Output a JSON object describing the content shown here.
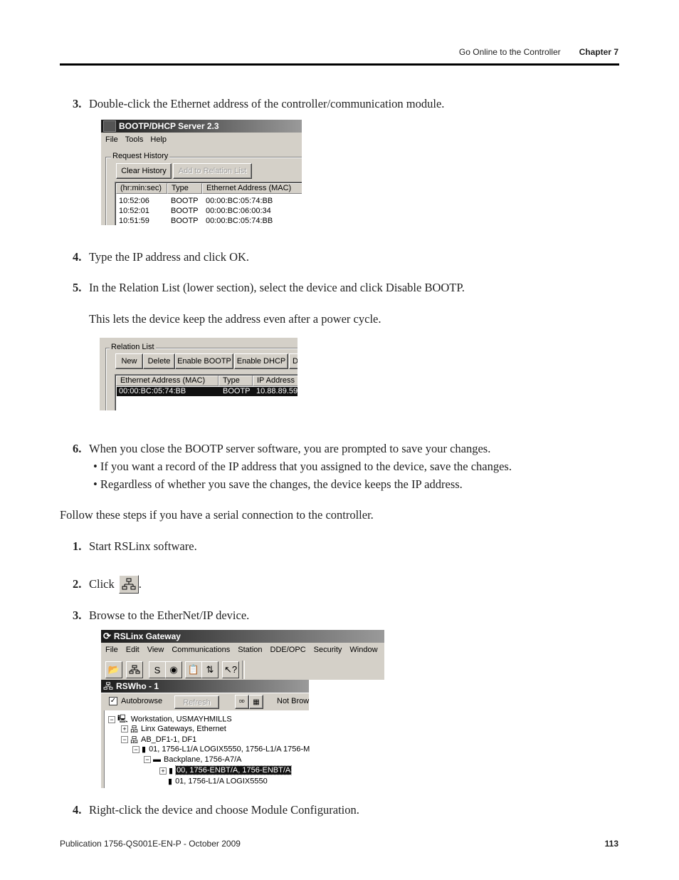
{
  "header": {
    "section": "Go Online to the Controller",
    "chapter": "Chapter 7"
  },
  "steps_a": [
    {
      "num": "3.",
      "text": "Double-click the Ethernet address of the controller/communication module."
    },
    {
      "num": "4.",
      "text": "Type the IP address and click OK."
    },
    {
      "num": "5.",
      "text": "In the Relation List (lower section), select the device and click Disable BOOTP."
    },
    {
      "num": "6.",
      "text": "When you close the BOOTP server software, you are prompted to save your changes."
    }
  ],
  "step5_note": "This lets the device keep the address even after a power cycle.",
  "step6_bullets": [
    "If you want a record of the IP address that you assigned to the device, save the changes.",
    "Regardless of whether you save the changes, the device keeps the IP address."
  ],
  "serial_intro": "Follow these steps if you have a serial connection to the controller.",
  "steps_b": [
    {
      "num": "1.",
      "text": "Start RSLinx software."
    },
    {
      "num": "2.",
      "text": "Click",
      "after": "."
    },
    {
      "num": "3.",
      "text": "Browse to the EtherNet/IP device."
    },
    {
      "num": "4.",
      "text": "Right-click the device and choose Module Configuration."
    }
  ],
  "bootp_window": {
    "title": "BOOTP/DHCP Server 2.3",
    "menu": [
      "File",
      "Tools",
      "Help"
    ],
    "group_label": "Request History",
    "buttons": {
      "clear": "Clear History",
      "add": "Add to Relation List"
    },
    "columns": [
      "(hr:min:sec)",
      "Type",
      "Ethernet Address (MAC)"
    ],
    "rows": [
      {
        "time": "10:52:06",
        "type": "BOOTP",
        "mac": "00:00:BC:05:74:BB"
      },
      {
        "time": "10:52:01",
        "type": "BOOTP",
        "mac": "00:00:BC:06:00:34"
      },
      {
        "time": "10:51:59",
        "type": "BOOTP",
        "mac": "00:00:BC:05:74:BB"
      }
    ]
  },
  "relation_list": {
    "group_label": "Relation List",
    "buttons": [
      "New",
      "Delete",
      "Enable BOOTP",
      "Enable DHCP",
      "D"
    ],
    "columns": [
      "Ethernet Address (MAC)",
      "Type",
      "IP Address"
    ],
    "rows": [
      {
        "mac": "00:00:BC:05:74:BB",
        "type": "BOOTP",
        "ip": "10.88.89.59"
      }
    ]
  },
  "rslinx": {
    "title": "RSLinx Gateway",
    "menu": [
      "File",
      "Edit",
      "View",
      "Communications",
      "Station",
      "DDE/OPC",
      "Security",
      "Window",
      "Help"
    ],
    "toolbar_icons": [
      "open-icon",
      "rswho-network-icon",
      "configure-driver-icon",
      "configure-shortcut-icon",
      "clipboard-icon",
      "topology-icon",
      "help-pointer-icon"
    ],
    "rswho": {
      "title": "RSWho - 1",
      "autobrowse_label": "Autobrowse",
      "autobrowse_checked": true,
      "refresh_label": "Refresh",
      "status": "Not Brow",
      "tree": [
        {
          "level": 0,
          "exp": "−",
          "icon": "workstation",
          "label": "Workstation, USMAYHMILLS"
        },
        {
          "level": 1,
          "exp": "+",
          "icon": "network",
          "label": "Linx Gateways, Ethernet"
        },
        {
          "level": 1,
          "exp": "−",
          "icon": "network",
          "label": "AB_DF1-1, DF1"
        },
        {
          "level": 2,
          "exp": "−",
          "icon": "module",
          "label": "01, 1756-L1/A LOGIX5550, 1756-L1/A 1756-M"
        },
        {
          "level": 3,
          "exp": "−",
          "icon": "backplane",
          "label": "Backplane, 1756-A7/A"
        },
        {
          "level": 4,
          "exp": "+",
          "icon": "module",
          "label": "00, 1756-ENBT/A, 1756-ENBT/A",
          "selected": true
        },
        {
          "level": 4,
          "exp": "",
          "icon": "module",
          "label": "01, 1756-L1/A LOGIX5550"
        }
      ]
    }
  },
  "footer": {
    "publication": "Publication 1756-QS001E-EN-P - October 2009",
    "page": "113"
  }
}
